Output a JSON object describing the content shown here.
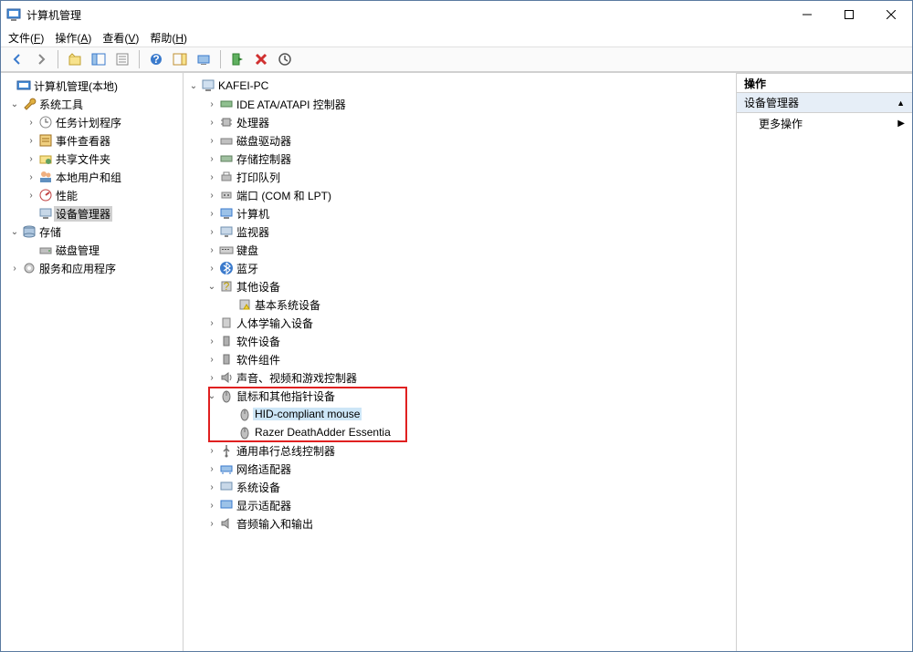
{
  "window": {
    "title": "计算机管理"
  },
  "menu": {
    "file": "文件(F)",
    "action": "操作(A)",
    "view": "查看(V)",
    "help": "帮助(H)"
  },
  "left": {
    "root": "计算机管理(本地)",
    "sys_tools": "系统工具",
    "task_sched": "任务计划程序",
    "event_viewer": "事件查看器",
    "shared": "共享文件夹",
    "users": "本地用户和组",
    "perf": "性能",
    "devmgr": "设备管理器",
    "storage": "存储",
    "diskmgmt": "磁盘管理",
    "services": "服务和应用程序"
  },
  "mid": {
    "pc": "KAFEI-PC",
    "ide": "IDE ATA/ATAPI 控制器",
    "cpu": "处理器",
    "disk": "磁盘驱动器",
    "storage_ctrl": "存储控制器",
    "print": "打印队列",
    "ports": "端口 (COM 和 LPT)",
    "computer": "计算机",
    "monitor": "监视器",
    "keyboard": "键盘",
    "bluetooth": "蓝牙",
    "other": "其他设备",
    "base_sys": "基本系统设备",
    "hid": "人体学输入设备",
    "soft_dev": "软件设备",
    "soft_comp": "软件组件",
    "sound": "声音、视频和游戏控制器",
    "mouse_cat": "鼠标和其他指针设备",
    "mouse1": "HID-compliant mouse",
    "mouse2": "Razer DeathAdder Essentia",
    "usb": "通用串行总线控制器",
    "net": "网络适配器",
    "sysdev": "系统设备",
    "display": "显示适配器",
    "audio": "音频输入和输出"
  },
  "right": {
    "header": "操作",
    "section": "设备管理器",
    "more": "更多操作"
  }
}
